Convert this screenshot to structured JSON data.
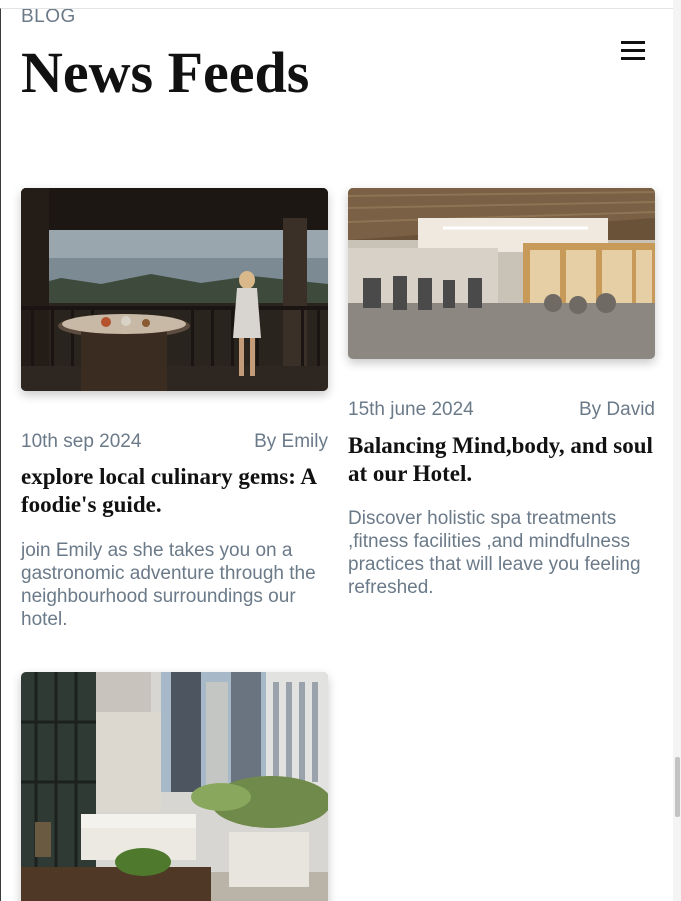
{
  "header": {
    "eyebrow": "BLOG",
    "title": "News Feeds",
    "menu_icon": "hamburger-menu-icon"
  },
  "posts": [
    {
      "image": "hotel balcony overlooking the sea with a woman standing at the railing",
      "date": "10th sep 2024",
      "author": "By Emily",
      "title": "explore local culinary gems: A foodie's guide.",
      "description": "join Emily as she takes you on a gastronomic adventure through the neighbourhood surroundings our hotel."
    },
    {
      "image": "hotel fitness center with treadmills and exercise balls",
      "date": "15th june 2024",
      "author": "By David",
      "title": "Balancing Mind,body, and soul at our Hotel.",
      "description": "Discover holistic spa treatments ,fitness facilities ,and mindfulness practices that will leave you feeling refreshed."
    },
    {
      "image": "rooftop terrace lounge with white wicker sofas among city skyscrapers"
    }
  ]
}
